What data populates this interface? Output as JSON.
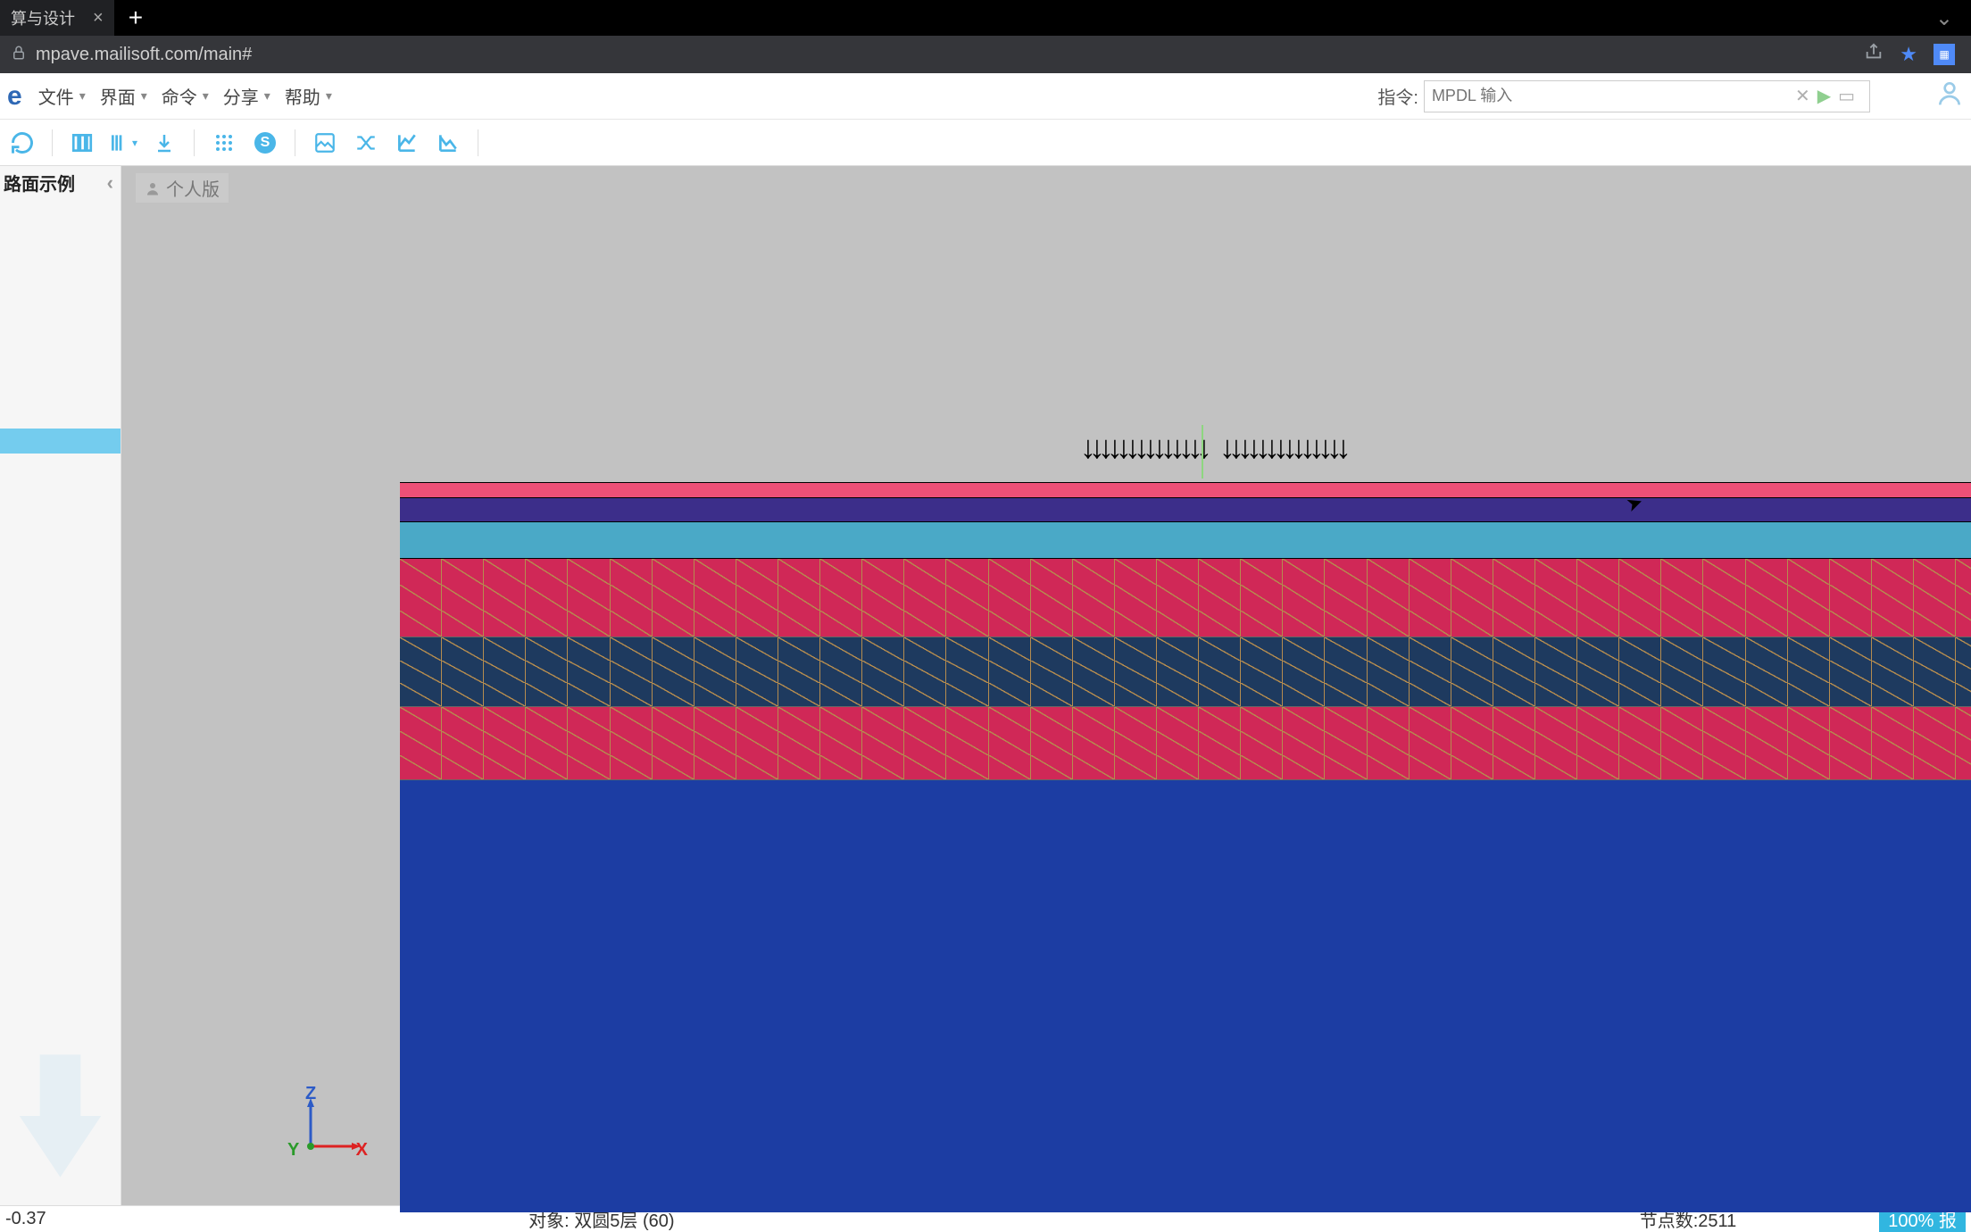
{
  "browser": {
    "tab_title": "算与设计",
    "url": "mpave.mailisoft.com/main#"
  },
  "menu": {
    "logo": "e",
    "items": [
      "文件",
      "界面",
      "命令",
      "分享",
      "帮助"
    ],
    "cmd_label": "指令:",
    "cmd_placeholder": "MPDL 输入"
  },
  "sidebar": {
    "title": "路面示例"
  },
  "viewport": {
    "tag": "个人版"
  },
  "axes": {
    "z": "Z",
    "y": "Y",
    "x": "X"
  },
  "status": {
    "left": "-0.37",
    "object_label": "对象:",
    "object_value": "双圆5层 (60)",
    "nodes_label": "节点数:",
    "nodes_value": "2511",
    "progress": "100% 报"
  }
}
